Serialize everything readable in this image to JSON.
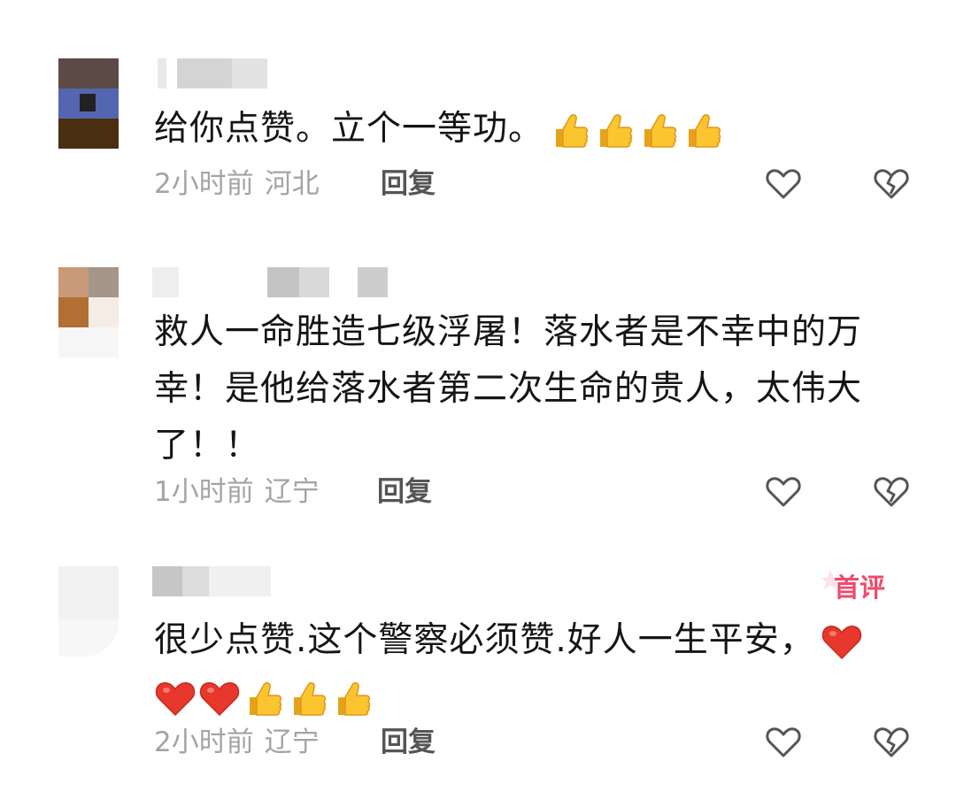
{
  "comments": [
    {
      "text": "给你点赞。立个一等功。",
      "emojis": [
        "thumbs-up",
        "thumbs-up",
        "thumbs-up",
        "thumbs-up"
      ],
      "time": "2小时前",
      "location": "河北",
      "reply_label": "回复"
    },
    {
      "text": "救人一命胜造七级浮屠！落水者是不幸中的万幸！是他给落水者第二次生命的贵人，太伟大了！！",
      "emojis": [],
      "time": "1小时前",
      "location": "辽宁",
      "reply_label": "回复"
    },
    {
      "text": "很少点赞.这个警察必须赞.好人一生平安，",
      "emojis": [
        "red-heart",
        "red-heart",
        "red-heart",
        "thumbs-up",
        "thumbs-up",
        "thumbs-up"
      ],
      "time": "2小时前",
      "location": "辽宁",
      "reply_label": "回复",
      "badge": "首评"
    }
  ],
  "colors": {
    "text": "#151515",
    "meta": "#a4a4a4",
    "reply": "#555555",
    "badge": "#f04a6b",
    "icon": "#555555"
  }
}
